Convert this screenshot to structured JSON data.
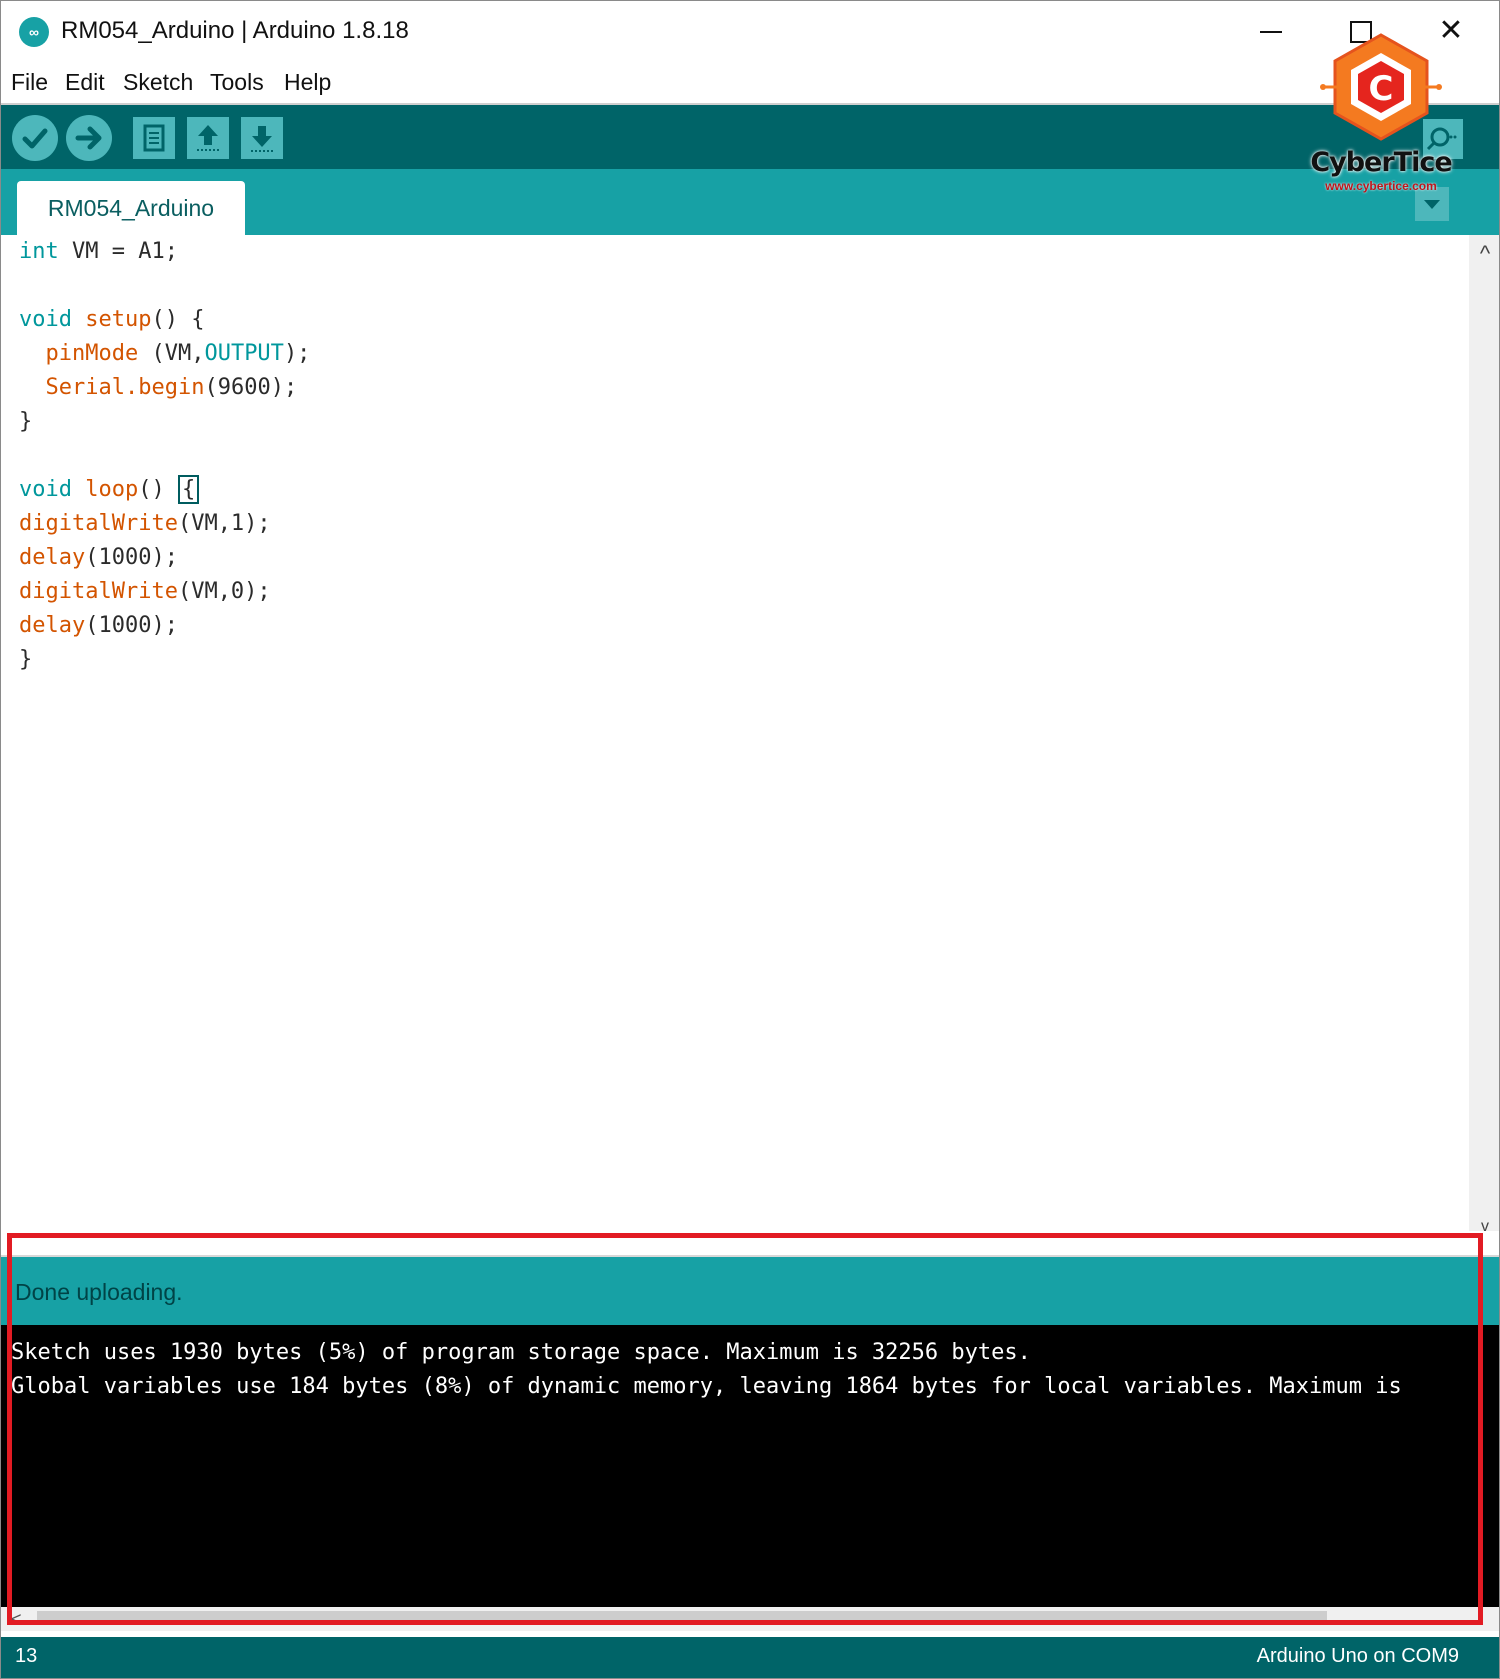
{
  "window": {
    "title": "RM054_Arduino | Arduino 1.8.18",
    "app_icon": "arduino-logo-icon",
    "controls": [
      "minimize-icon",
      "maximize-icon",
      "close-icon"
    ],
    "close_glyph": "✕"
  },
  "menu": [
    "File",
    "Edit",
    "Sketch",
    "Tools",
    "Help"
  ],
  "toolbar": {
    "buttons": [
      "verify-icon",
      "upload-icon",
      "new-icon",
      "open-icon",
      "save-icon"
    ],
    "serial_monitor": "serial-monitor-icon"
  },
  "tab": {
    "label": "RM054_Arduino",
    "menu_icon": "chevron-down-icon"
  },
  "logo": {
    "name": "CyberTice",
    "url": "www.cybertice.com"
  },
  "editor": {
    "scroll_up_glyph": "^",
    "scroll_down_glyph": "v",
    "code": {
      "line1": {
        "kw": "int",
        "rest": " VM = A1;"
      },
      "line2": {},
      "line3": {
        "kw": "void",
        "fn": "setup",
        "rest": "() {"
      },
      "line4": {
        "indent": "  ",
        "fn": "pinMode",
        "rest1": " (VM,",
        "kw": "OUTPUT",
        "rest2": ");"
      },
      "line5": {
        "indent": "  ",
        "fn1": "Serial",
        "dot": ".",
        "fn2": "begin",
        "rest": "(9600);"
      },
      "line6": {
        "rest": "}"
      },
      "line7": {},
      "line8": {
        "kw": "void",
        "fn": "loop",
        "rest": "() ",
        "cursor": "{"
      },
      "line9": {
        "fn": "digitalWrite",
        "rest": "(VM,1);"
      },
      "line10": {
        "fn": "delay",
        "rest": "(1000);"
      },
      "line11": {
        "fn": "digitalWrite",
        "rest": "(VM,0);"
      },
      "line12": {
        "fn": "delay",
        "rest": "(1000);"
      },
      "line13": {
        "rest": "}"
      }
    }
  },
  "status": {
    "message": "Done uploading."
  },
  "console": {
    "lines": [
      "Sketch uses 1930 bytes (5%) of program storage space. Maximum is 32256 bytes.",
      "Global variables use 184 bytes (8%) of dynamic memory, leaving 1864 bytes for local variables. Maximum is"
    ],
    "scroll_left_glyph": "<"
  },
  "footer": {
    "line_number": "13",
    "board": "Arduino Uno on COM9"
  },
  "colors": {
    "teal_dark": "#006468",
    "teal": "#17a1a5",
    "keyword": "#00979c",
    "function": "#d35400",
    "highlight": "#e21b23"
  }
}
